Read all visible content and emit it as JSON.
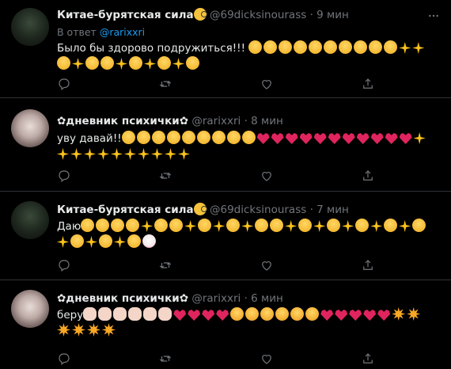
{
  "tweets": [
    {
      "name": "Китае-бурятская сила",
      "handle": "@69dicksinourass",
      "sep": "·",
      "time": "9 мин",
      "reply_prefix": "В ответ",
      "reply_mention": "@rarixxri",
      "text": "Было бы здорово подружиться!!!",
      "emojis": [
        "smile",
        "smile",
        "smile",
        "smile",
        "smile",
        "smile",
        "smile",
        "smile",
        "smile",
        "smile",
        "spark",
        "spark",
        "smile",
        "spark",
        "smile",
        "smile",
        "spark",
        "smile",
        "spark",
        "smile",
        "spark",
        "smile"
      ]
    },
    {
      "name": "✿дневник психички✿",
      "handle": "@rarixxri",
      "sep": "·",
      "time": "8 мин",
      "text": "уву давай!!",
      "emojis": [
        "smile",
        "smile",
        "smile",
        "smile",
        "smile",
        "smile",
        "smile",
        "smile",
        "smile",
        "heart",
        "heart",
        "heart",
        "heart",
        "heart",
        "heart",
        "heart",
        "heart",
        "heart",
        "heart",
        "heart",
        "spark",
        "spark",
        "spark",
        "spark",
        "spark",
        "spark",
        "spark",
        "spark",
        "spark",
        "spark",
        "spark"
      ]
    },
    {
      "name": "Китае-бурятская сила",
      "handle": "@69dicksinourass",
      "sep": "·",
      "time": "7 мин",
      "text": "Даю",
      "emojis": [
        "smile",
        "smile",
        "smile",
        "smile",
        "spark",
        "smile",
        "smile",
        "spark",
        "smile",
        "spark",
        "smile",
        "spark",
        "smile",
        "smile",
        "spark",
        "smile",
        "spark",
        "smile",
        "spark",
        "smile",
        "spark",
        "smile",
        "spark",
        "smile",
        "spark",
        "smile",
        "spark",
        "smile",
        "spark",
        "smile",
        "clown"
      ]
    },
    {
      "name": "✿дневник психички✿",
      "handle": "@rarixxri",
      "sep": "·",
      "time": "6 мин",
      "text": "беру",
      "emojis": [
        "hand",
        "hand",
        "hand",
        "hand",
        "hand",
        "hand",
        "heart",
        "heart",
        "heart",
        "heart",
        "hug",
        "hug",
        "hug",
        "hug",
        "hug",
        "hug",
        "heart",
        "heart",
        "heart",
        "heart",
        "heart",
        "sun",
        "sun",
        "sun",
        "sun",
        "sun",
        "sun"
      ]
    }
  ],
  "icons": {
    "reply": "reply-icon",
    "retweet": "retweet-icon",
    "like": "like-icon",
    "share": "share-icon",
    "more": "more-icon"
  },
  "colors": {
    "background": "#000000",
    "name": "#e7e9ea",
    "muted": "#71767b",
    "link": "#1d9bf0",
    "divider": "#2f3336"
  }
}
